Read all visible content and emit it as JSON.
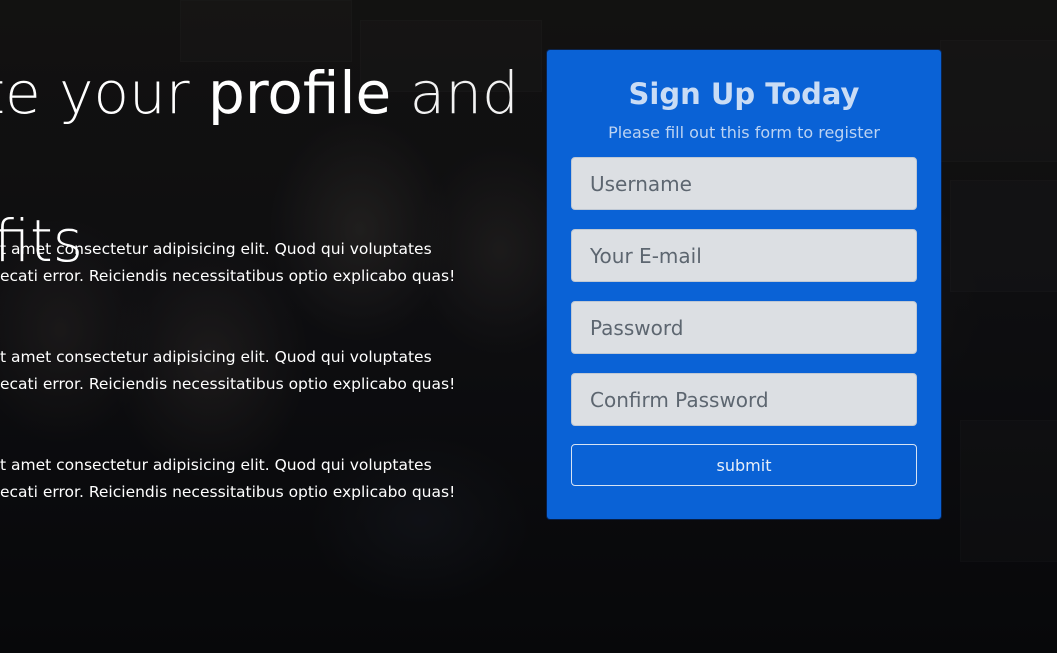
{
  "hero": {
    "heading_strong": "profile",
    "heading_rest": " and gain",
    "heading_line2": "ofits",
    "features": [
      {
        "line1": "t amet consectetur adipisicing elit. Quod qui voluptates",
        "line2": "ecati error. Reiciendis necessitatibus optio explicabo quas!"
      },
      {
        "line1": "t amet consectetur adipisicing elit. Quod qui voluptates",
        "line2": "ecati error. Reiciendis necessitatibus optio explicabo quas!"
      },
      {
        "line1": "t amet consectetur adipisicing elit. Quod qui voluptates",
        "line2": "ecati error. Reiciendis necessitatibus optio explicabo quas!"
      }
    ]
  },
  "signup": {
    "title": "Sign Up Today",
    "subtitle": "Please fill out this form to register",
    "username_placeholder": "Username",
    "email_placeholder": "Your E-mail",
    "password_placeholder": "Password",
    "confirm_password_placeholder": "Confirm Password",
    "submit_label": "submit"
  },
  "colors": {
    "card_background": "#0a62d6",
    "field_background": "#dcdfe3",
    "text_light": "#ffffff"
  }
}
